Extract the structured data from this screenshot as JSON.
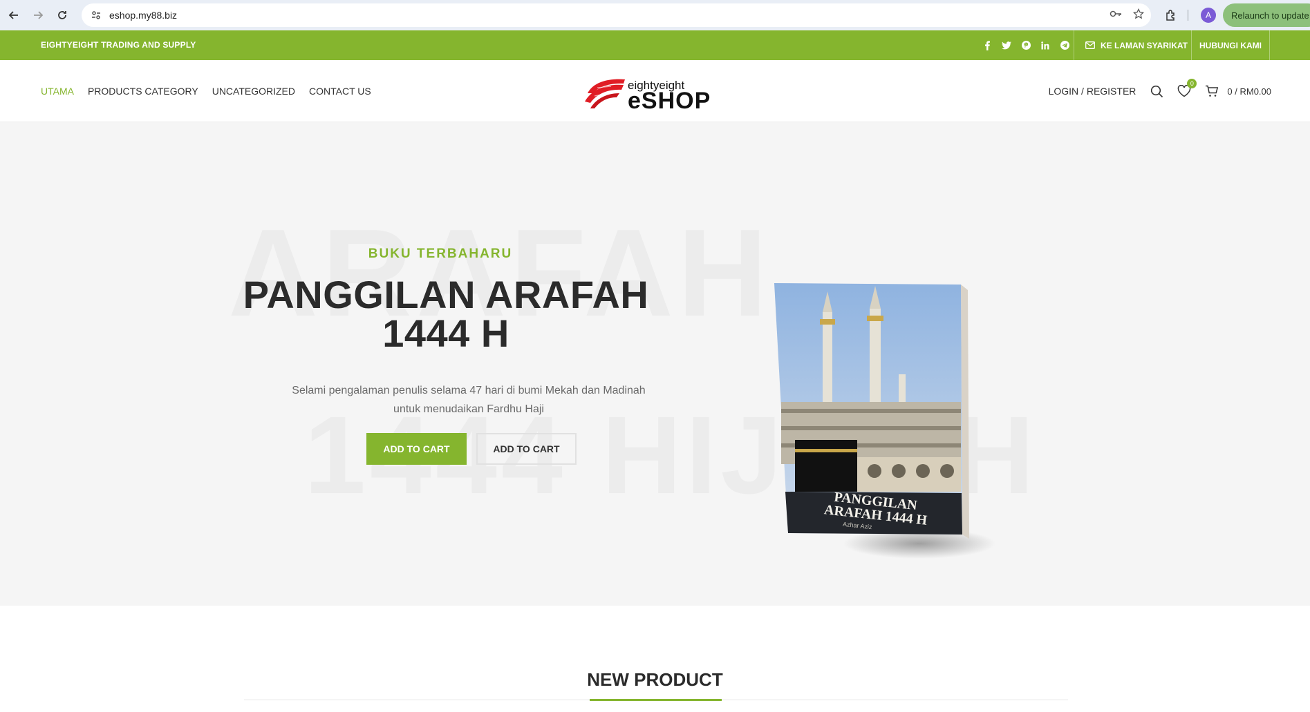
{
  "browser": {
    "url": "eshop.my88.biz",
    "avatar_letter": "A",
    "relaunch_label": "Relaunch to update"
  },
  "topbar": {
    "brand": "EIGHTYEIGHT TRADING AND SUPPLY",
    "social_icons": [
      "facebook-icon",
      "twitter-icon",
      "pinterest-icon",
      "linkedin-icon",
      "telegram-icon"
    ],
    "company_link": "KE LAMAN SYARIKAT",
    "contact_link": "HUBUNGI KAMI"
  },
  "header": {
    "menu": [
      "UTAMA",
      "PRODUCTS CATEGORY",
      "UNCATEGORIZED",
      "CONTACT US"
    ],
    "logo_top": "eightyeight",
    "logo_bottom": "eSHOP",
    "login": "LOGIN / REGISTER",
    "wishlist_count": "0",
    "cart_total": "0 / RM0.00"
  },
  "hero": {
    "bg_word_top": "ARAFAH",
    "bg_word_bottom": "1444 HIJRAH",
    "subtitle": "BUKU TERBAHARU",
    "title_line1": "PANGGILAN ARAFAH",
    "title_line2": "1444 H",
    "desc_line1": "Selami pengalaman penulis selama 47 hari di bumi Mekah dan Madinah",
    "desc_line2": "untuk menudaikan Fardhu Haji",
    "btn_primary": "ADD TO CART",
    "btn_secondary": "ADD TO CART",
    "book_title_line1": "PANGGILAN",
    "book_title_line2": "ARAFAH 1444 H",
    "book_author": "Azhar Aziz"
  },
  "sections": {
    "new_product": "NEW PRODUCT"
  },
  "colors": {
    "brand_green": "#85b52e",
    "text_dark": "#2b2b2b"
  }
}
